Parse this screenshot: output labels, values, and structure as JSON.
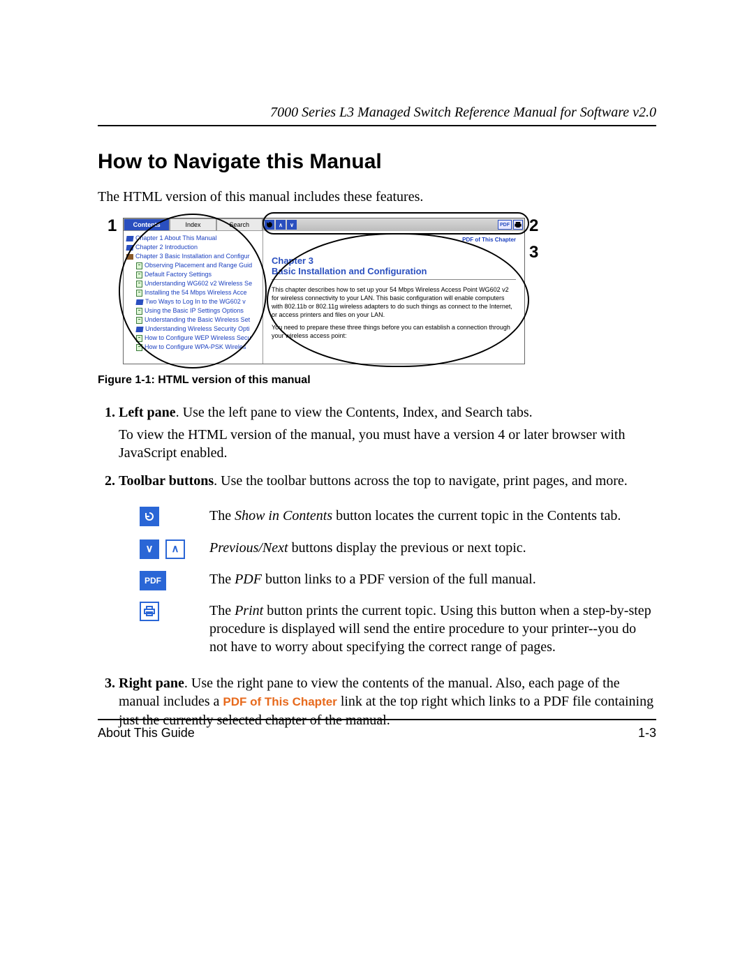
{
  "header": {
    "running_title": "7000 Series L3 Managed Switch Reference Manual for Software v2.0"
  },
  "h1": "How to Navigate this Manual",
  "intro": "The HTML version of this manual includes these features.",
  "callouts": {
    "one": "1",
    "two": "2",
    "three": "3"
  },
  "figure": {
    "tabs": {
      "contents": "Contents",
      "index": "Index",
      "search": "Search"
    },
    "tree": [
      {
        "label": "Chapter 1 About This Manual",
        "icon": "book"
      },
      {
        "label": "Chapter 2 Introduction",
        "icon": "book"
      },
      {
        "label": "Chapter 3 Basic Installation and Configur",
        "icon": "openbook"
      },
      {
        "label": "Observing Placement and Range Guid",
        "icon": "doc",
        "sub": true
      },
      {
        "label": "Default Factory Settings",
        "icon": "doc",
        "sub": true
      },
      {
        "label": "Understanding WG602 v2 Wireless Se",
        "icon": "doc",
        "sub": true
      },
      {
        "label": "Installing the 54 Mbps Wireless Acce",
        "icon": "doc",
        "sub": true
      },
      {
        "label": "Two Ways to Log In to the WG602 v",
        "icon": "book",
        "sub": true
      },
      {
        "label": "Using the Basic IP Settings Options",
        "icon": "doc",
        "sub": true
      },
      {
        "label": "Understanding the Basic Wireless Set",
        "icon": "doc",
        "sub": true
      },
      {
        "label": "Understanding Wireless Security Opti",
        "icon": "book",
        "sub": true
      },
      {
        "label": "How to Configure WEP Wireless Secu",
        "icon": "doc",
        "sub": true
      },
      {
        "label": "How to Configure WPA-PSK Wireles",
        "icon": "doc",
        "sub": true
      }
    ],
    "toolbar": {
      "show_in_contents": "↻",
      "next": "∧",
      "prev": "∨",
      "pdf": "PDF",
      "print": "⎙"
    },
    "content": {
      "pdf_link": "PDF of This Chapter",
      "chapter_num": "Chapter 3",
      "chapter_title": "Basic Installation and Configuration",
      "para1": "This chapter describes how to set up your 54 Mbps Wireless Access Point WG602 v2 for wireless connectivity to your LAN. This basic configuration will enable computers with 802.11b or 802.11g wireless adapters to do such things as connect to the Internet, or access printers and files on your LAN.",
      "para2": "You need to prepare these three things before you can establish a connection through your wireless access point:"
    }
  },
  "caption": "Figure 1-1:  HTML version of this manual",
  "list": {
    "item1": {
      "lead": "Left pane",
      "rest": ". Use the left pane to view the Contents, Index, and Search tabs.",
      "para": "To view the HTML version of the manual, you must have a version 4 or later browser with JavaScript enabled."
    },
    "item2": {
      "lead": "Toolbar buttons",
      "rest": ". Use the toolbar buttons across the top to navigate, print pages, and more."
    },
    "item3": {
      "lead": "Right pane",
      "rest_a": ". Use the right pane to view the contents of the manual. Also, each page of the manual includes a ",
      "inline_pdf": "PDF of This Chapter",
      "rest_b": " link at the top right which links to a PDF file containing just the currently selected chapter of the manual."
    }
  },
  "icon_rows": {
    "show": {
      "pre": "The ",
      "em": "Show in Contents",
      "post": " button locates the current topic in the Contents tab."
    },
    "prevnext": {
      "em": "Previous/Next",
      "post": " buttons display the previous or next topic."
    },
    "pdf": {
      "pre": "The ",
      "em": "PDF",
      "post": " button links to a PDF version of the full manual."
    },
    "print": {
      "pre": "The ",
      "em": "Print",
      "post": " button prints the current topic. Using this button when a step-by-step procedure is displayed will send the entire procedure to your printer--you do not have to worry about specifying the correct range of pages."
    }
  },
  "footer": {
    "left": "About This Guide",
    "right": "1-3"
  }
}
